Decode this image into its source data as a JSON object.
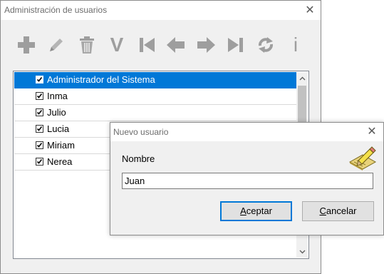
{
  "main_window": {
    "title": "Administración de usuarios",
    "close_glyph": "✕",
    "toolbar": [
      {
        "name": "add-icon",
        "tooltip": ""
      },
      {
        "name": "edit-pencil-icon"
      },
      {
        "name": "trash-icon"
      },
      {
        "name": "check-v-icon",
        "glyph": "V"
      },
      {
        "name": "first-record-icon"
      },
      {
        "name": "previous-arrow-icon"
      },
      {
        "name": "next-arrow-icon"
      },
      {
        "name": "last-record-icon"
      },
      {
        "name": "refresh-icon"
      },
      {
        "name": "info-icon",
        "glyph": "i"
      }
    ],
    "users": [
      {
        "label": "Administrador del Sistema",
        "checked": true,
        "selected": true
      },
      {
        "label": "Inma",
        "checked": true,
        "selected": false
      },
      {
        "label": "Julio",
        "checked": true,
        "selected": false
      },
      {
        "label": "Lucia",
        "checked": true,
        "selected": false
      },
      {
        "label": "Miriam",
        "checked": true,
        "selected": false
      },
      {
        "label": "Nerea",
        "checked": true,
        "selected": false
      }
    ]
  },
  "dialog": {
    "title": "Nuevo usuario",
    "close_glyph": "✕",
    "name_label": "Nombre",
    "name_value": "Juan",
    "accept_button": {
      "accel": "A",
      "rest": "ceptar"
    },
    "cancel_button": {
      "accel": "C",
      "rest": "ancelar"
    }
  },
  "colors": {
    "selection": "#0078d7",
    "toolbar_icon": "#9e9e9e",
    "window_bg": "#f0f0f0"
  }
}
